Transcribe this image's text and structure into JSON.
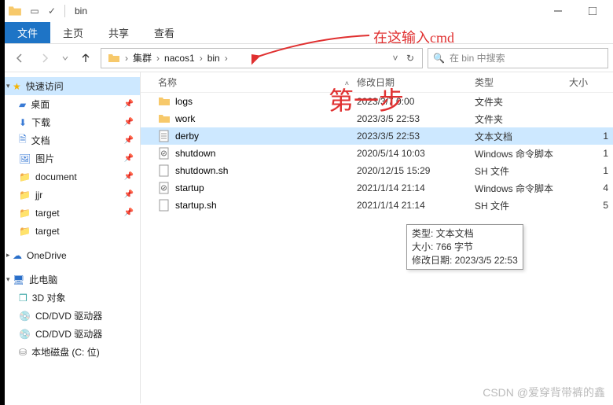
{
  "titlebar": {
    "title": "bin"
  },
  "ribbon": {
    "file": "文件",
    "tabs": [
      "主页",
      "共享",
      "查看"
    ]
  },
  "breadcrumbs": [
    "集群",
    "nacos1",
    "bin"
  ],
  "search": {
    "placeholder": "在 bin 中搜索"
  },
  "columns": {
    "name": "名称",
    "date": "修改日期",
    "type": "类型",
    "size": "大小"
  },
  "files": [
    {
      "icon": "folder",
      "name": "logs",
      "date": "2023/3/7 0:00",
      "type": "文件夹",
      "size": ""
    },
    {
      "icon": "folder",
      "name": "work",
      "date": "2023/3/5 22:53",
      "type": "文件夹",
      "size": ""
    },
    {
      "icon": "txt",
      "name": "derby",
      "date": "2023/3/5 22:53",
      "type": "文本文档",
      "size": "1",
      "selected": true
    },
    {
      "icon": "cmd",
      "name": "shutdown",
      "date": "2020/5/14 10:03",
      "type": "Windows 命令脚本",
      "size": "1"
    },
    {
      "icon": "file",
      "name": "shutdown.sh",
      "date": "2020/12/15 15:29",
      "type": "SH 文件",
      "size": "1"
    },
    {
      "icon": "cmd",
      "name": "startup",
      "date": "2021/1/14 21:14",
      "type": "Windows 命令脚本",
      "size": "4"
    },
    {
      "icon": "file",
      "name": "startup.sh",
      "date": "2021/1/14 21:14",
      "type": "SH 文件",
      "size": "5"
    }
  ],
  "tooltip": {
    "l1": "类型: 文本文档",
    "l2": "大小: 766 字节",
    "l3": "修改日期: 2023/3/5 22:53"
  },
  "sidebar": {
    "quick": "快速访问",
    "items1": [
      "桌面",
      "下载",
      "文档",
      "图片",
      "document",
      "jjr",
      "target",
      "target"
    ],
    "onedrive": "OneDrive",
    "thispc": "此电脑",
    "items2": [
      "3D 对象",
      "CD/DVD 驱动器",
      "CD/DVD 驱动器",
      "本地磁盘 (C: 位)"
    ]
  },
  "annotations": {
    "t1": "在这输入cmd",
    "t2": "第一步",
    "watermark": "CSDN @爱穿背带裤的鑫"
  }
}
